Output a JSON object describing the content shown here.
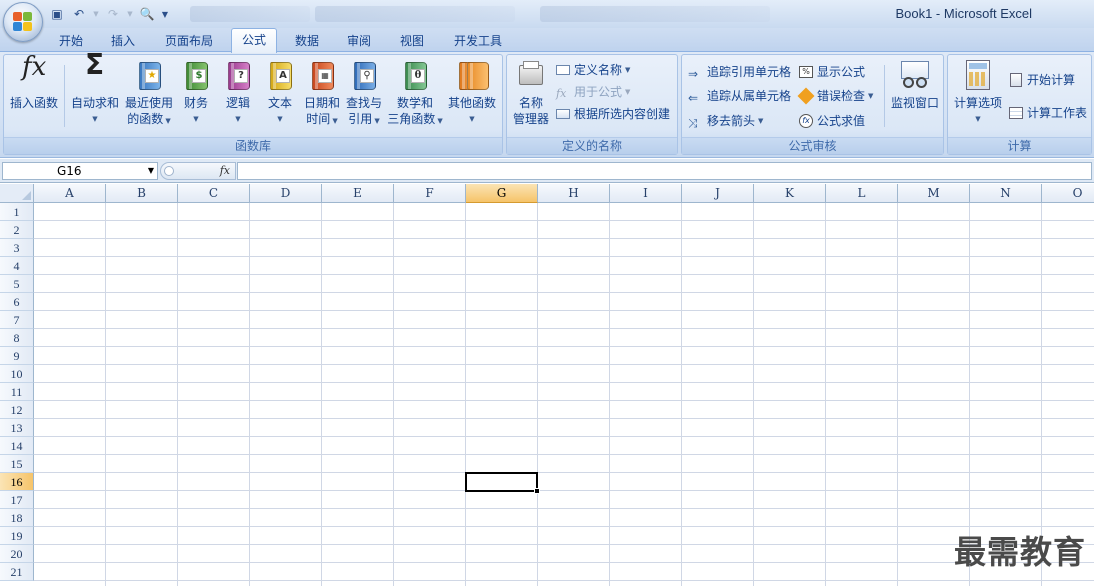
{
  "window": {
    "title": "Book1 - Microsoft Excel"
  },
  "tabs": [
    "开始",
    "插入",
    "页面布局",
    "公式",
    "数据",
    "审阅",
    "视图",
    "开发工具"
  ],
  "active_tab": "公式",
  "groups": {
    "function_library": {
      "label": "函数库",
      "insert_function": "插入函数",
      "autosum": "自动求和",
      "recent_1": "最近使用",
      "recent_2": "的函数",
      "financial": "财务",
      "logical": "逻辑",
      "text": "文本",
      "datetime_1": "日期和",
      "datetime_2": "时间",
      "lookup_1": "查找与",
      "lookup_2": "引用",
      "math_1": "数学和",
      "math_2": "三角函数",
      "more": "其他函数"
    },
    "defined_names": {
      "label": "定义的名称",
      "name_manager_1": "名称",
      "name_manager_2": "管理器",
      "define_name": "定义名称",
      "use_in_formula": "用于公式",
      "create_from_selection": "根据所选内容创建"
    },
    "formula_auditing": {
      "label": "公式审核",
      "trace_precedents": "追踪引用单元格",
      "trace_dependents": "追踪从属单元格",
      "remove_arrows": "移去箭头",
      "show_formulas": "显示公式",
      "error_checking": "错误检查",
      "evaluate_formula": "公式求值",
      "watch_window": "监视窗口"
    },
    "calculation": {
      "label": "计算",
      "calc_options": "计算选项",
      "calc_now": "开始计算",
      "calc_sheet": "计算工作表"
    }
  },
  "formula_bar": {
    "name_box": "G16",
    "fx_label": "fx",
    "content": ""
  },
  "grid": {
    "columns": [
      "A",
      "B",
      "C",
      "D",
      "E",
      "F",
      "G",
      "H",
      "I",
      "J",
      "K",
      "L",
      "M",
      "N",
      "O"
    ],
    "rows": [
      "1",
      "2",
      "3",
      "4",
      "5",
      "6",
      "7",
      "8",
      "9",
      "10",
      "11",
      "12",
      "13",
      "14",
      "15",
      "16",
      "17",
      "18",
      "19",
      "20",
      "21"
    ],
    "selected_column": "G",
    "selected_row": "16"
  },
  "watermark": "最需教育",
  "icons": {
    "insert_function": "fx-icon",
    "autosum": "sigma-icon",
    "colors": {
      "recent": "#5b9bd5",
      "financial": "#5aa04a",
      "logical": "#b04aa0",
      "text": "#e8c43a",
      "datetime": "#e06030",
      "lookup": "#3d7cc9",
      "math": "#4aa060",
      "more": "#f08a2a"
    }
  }
}
